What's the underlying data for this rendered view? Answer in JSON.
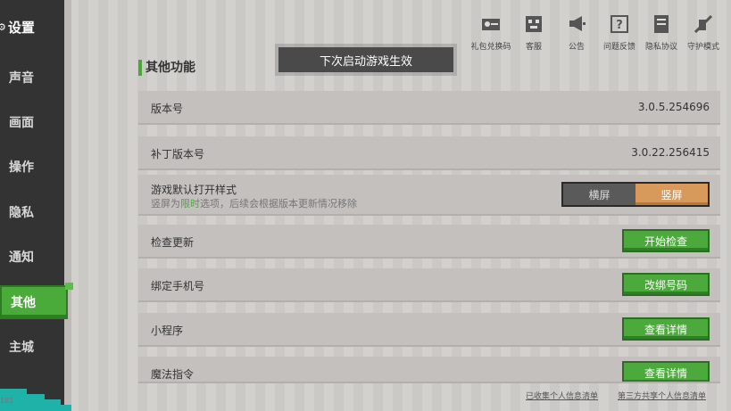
{
  "sidebar": {
    "title": "设置",
    "items": [
      {
        "label": "声音"
      },
      {
        "label": "画面"
      },
      {
        "label": "操作"
      },
      {
        "label": "隐私"
      },
      {
        "label": "通知"
      },
      {
        "label": "其他",
        "active": true
      },
      {
        "label": "主城"
      }
    ],
    "bottom_text": "181"
  },
  "top_icons": [
    {
      "label": "礼包兑换码",
      "icon": "key-icon"
    },
    {
      "label": "客服",
      "icon": "support-icon"
    },
    {
      "label": "公告",
      "icon": "megaphone-icon"
    },
    {
      "label": "问题反馈",
      "icon": "question-icon"
    },
    {
      "label": "隐私协议",
      "icon": "document-icon"
    },
    {
      "label": "守护模式",
      "icon": "guard-icon"
    }
  ],
  "toast": "下次启动游戏生效",
  "section_title": "其他功能",
  "rows": {
    "version": {
      "label": "版本号",
      "value": "3.0.5.254696"
    },
    "patch": {
      "label": "补丁版本号",
      "value": "3.0.22.256415"
    },
    "orientation": {
      "label": "游戏默认打开样式",
      "sub_prefix": "竖屏为",
      "sub_highlight": "限时",
      "sub_suffix": "选项，后续会根据版本更新情况移除",
      "option_landscape": "横屏",
      "option_portrait": "竖屏",
      "selected": "竖屏"
    },
    "update": {
      "label": "检查更新",
      "button": "开始检查"
    },
    "phone": {
      "label": "绑定手机号",
      "button": "改绑号码"
    },
    "miniprogram": {
      "label": "小程序",
      "button": "查看详情"
    },
    "magic": {
      "label": "魔法指令",
      "button": "查看详情"
    }
  },
  "footer": {
    "collected": "已收集个人信息清单",
    "shared": "第三方共享个人信息清单"
  },
  "colors": {
    "accent_green": "#4caa3c",
    "selected_orange": "#d89a5a",
    "sidebar_bg": "#323332"
  }
}
